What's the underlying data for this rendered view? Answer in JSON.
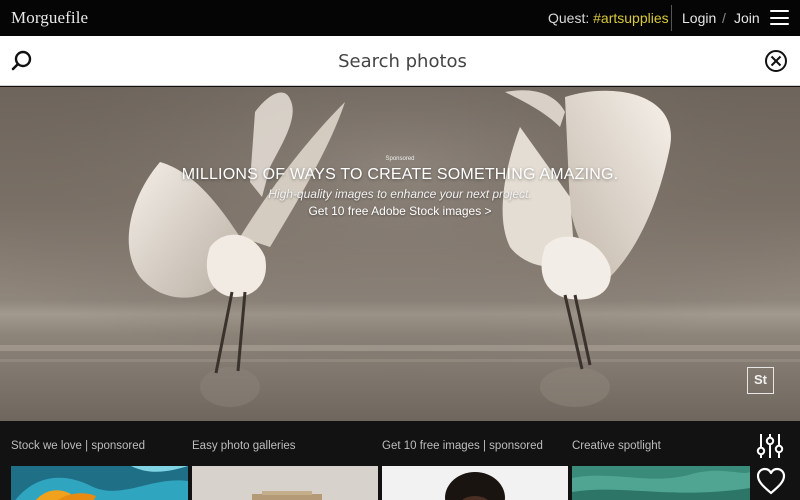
{
  "header": {
    "logo": "Morguefile",
    "quest_label": "Quest:",
    "quest_tag": "#artsupplies",
    "login": "Login",
    "separator": "/",
    "join": "Join"
  },
  "search": {
    "placeholder": "Search photos",
    "value": ""
  },
  "hero": {
    "sponsored": "Sponsored",
    "headline": "MILLIONS OF WAYS TO CREATE SOMETHING AMAZING.",
    "subline": "High-quality images to enhance your next project.",
    "cta": "Get 10 free Adobe Stock images >",
    "badge": "St"
  },
  "strip": {
    "sections": [
      {
        "label": "Stock we love | sponsored"
      },
      {
        "label": "Easy photo galleries"
      },
      {
        "label": "Get 10 free images | sponsored"
      },
      {
        "label": "Creative spotlight"
      }
    ]
  },
  "icons": {
    "menu": "hamburger-menu-icon",
    "search": "search-icon",
    "clear": "close-circle-icon",
    "filters": "sliders-icon",
    "favorites": "heart-icon"
  },
  "colors": {
    "accent_tag": "#d9c93a",
    "topbar_bg": "#050505",
    "strip_bg": "#121212"
  }
}
